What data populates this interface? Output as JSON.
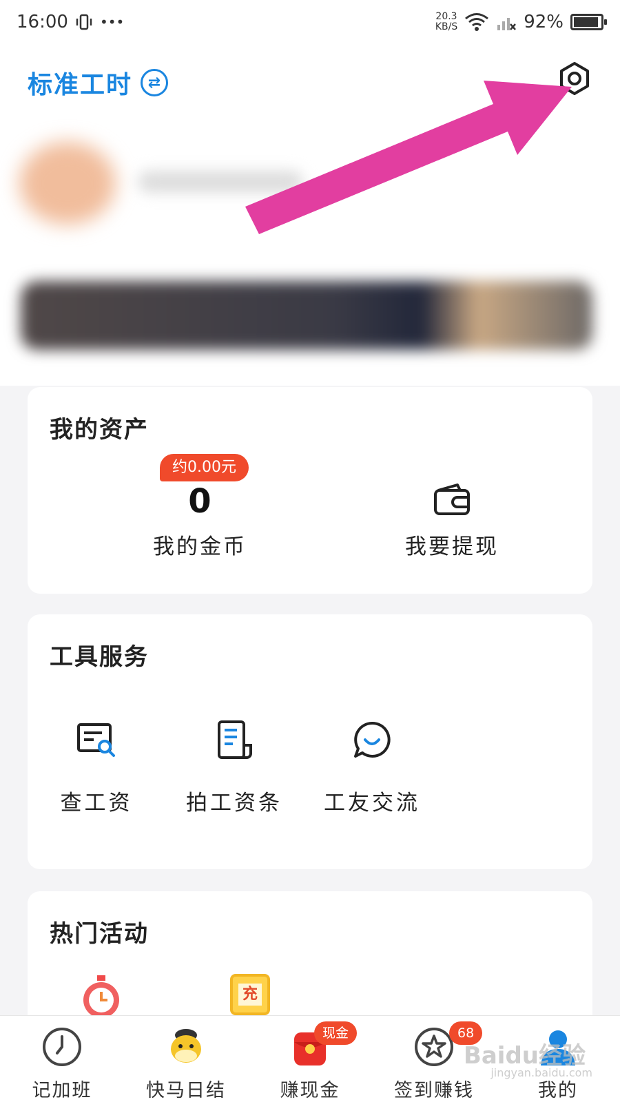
{
  "colors": {
    "accent": "#1a86e0",
    "badge": "#f04a2b",
    "arrow": "#e23ea0",
    "text": "#222222"
  },
  "status": {
    "time": "16:00",
    "dots": "•••",
    "netspeed_value": "20.3",
    "netspeed_unit": "KB/S",
    "battery": "92%",
    "battery_level": 0.92
  },
  "header": {
    "title": "标准工时",
    "switch_icon": "⇄",
    "settings_icon": "gear-icon"
  },
  "assets": {
    "title": "我的资产",
    "coin_badge": "约0.00元",
    "coin_value": "0",
    "coin_label": "我的金币",
    "withdraw_label": "我要提现"
  },
  "tools": {
    "title": "工具服务",
    "items": [
      {
        "label": "查工资",
        "icon": "salary-search-icon"
      },
      {
        "label": "拍工资条",
        "icon": "payslip-icon"
      },
      {
        "label": "工友交流",
        "icon": "chat-icon"
      }
    ]
  },
  "hot": {
    "title": "热门活动",
    "items": [
      {
        "icon": "alarm-clock-icon"
      },
      {
        "icon": "recharge-icon",
        "label": "充"
      }
    ]
  },
  "tabbar": {
    "items": [
      {
        "label": "记加班",
        "icon": "clock-icon"
      },
      {
        "label": "快马日结",
        "icon": "horse-icon"
      },
      {
        "label": "赚现金",
        "icon": "red-envelope-icon",
        "badge": "现金"
      },
      {
        "label": "签到赚钱",
        "icon": "star-icon",
        "badge": "68"
      },
      {
        "label": "我的",
        "icon": "user-icon"
      }
    ]
  },
  "watermark": {
    "brand": "Baidu经验",
    "sub": "jingyan.baidu.com"
  }
}
